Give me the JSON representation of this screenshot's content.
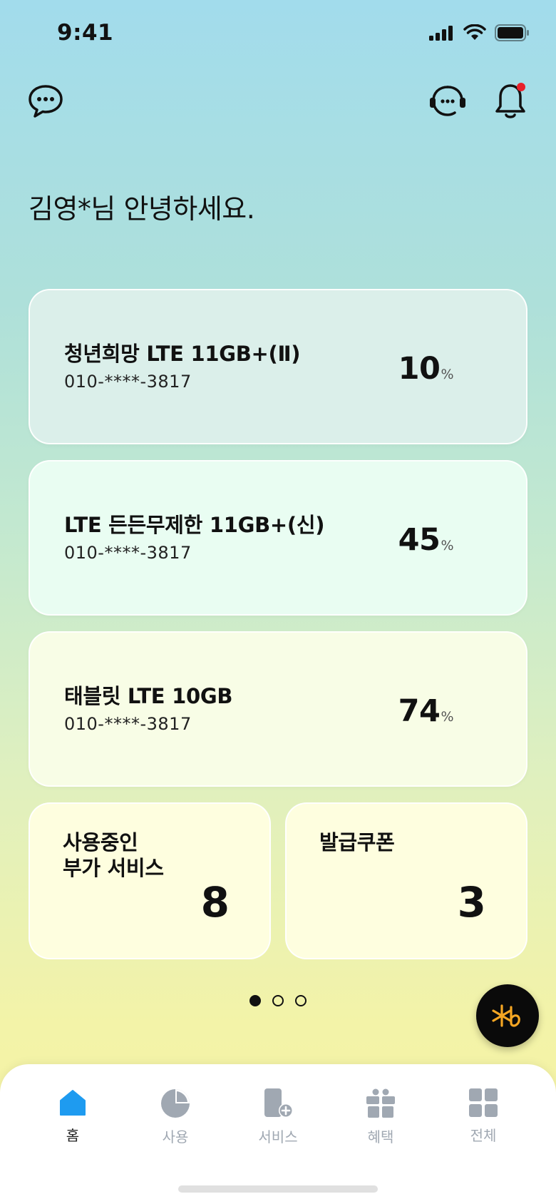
{
  "status_bar": {
    "time": "9:41"
  },
  "greeting": "김영*님 안녕하세요.",
  "plans": [
    {
      "name": "청년희망 LTE 11GB+(Ⅱ)",
      "phone": "010-****-3817",
      "percent": "10",
      "unit": "%",
      "bg": "#dbefea"
    },
    {
      "name": "LTE 든든무제한 11GB+(신)",
      "phone": "010-****-3817",
      "percent": "45",
      "unit": "%",
      "bg": "#e9fdf2"
    },
    {
      "name": "태블릿 LTE 10GB",
      "phone": "010-****-3817",
      "percent": "74",
      "unit": "%",
      "bg": "#f8fde6"
    }
  ],
  "summary": {
    "addons": {
      "label_line1": "사용중인",
      "label_line2": "부가 서비스",
      "value": "8"
    },
    "coupons": {
      "label": "발급쿠폰",
      "value": "3"
    }
  },
  "pager": {
    "count": 3,
    "active": 1
  },
  "nav": {
    "items": [
      {
        "label": "홈",
        "icon": "home-icon"
      },
      {
        "label": "사용",
        "icon": "pie-chart-icon"
      },
      {
        "label": "서비스",
        "icon": "phone-add-icon"
      },
      {
        "label": "혜택",
        "icon": "gift-icon"
      },
      {
        "label": "전체",
        "icon": "grid-icon"
      }
    ],
    "active_index": 0,
    "accent_color": "#1e9bf0",
    "inactive_color": "#a0a8b2"
  },
  "colors": {
    "notification_dot": "#e8202a",
    "fab_symbol": "#f5a623"
  }
}
